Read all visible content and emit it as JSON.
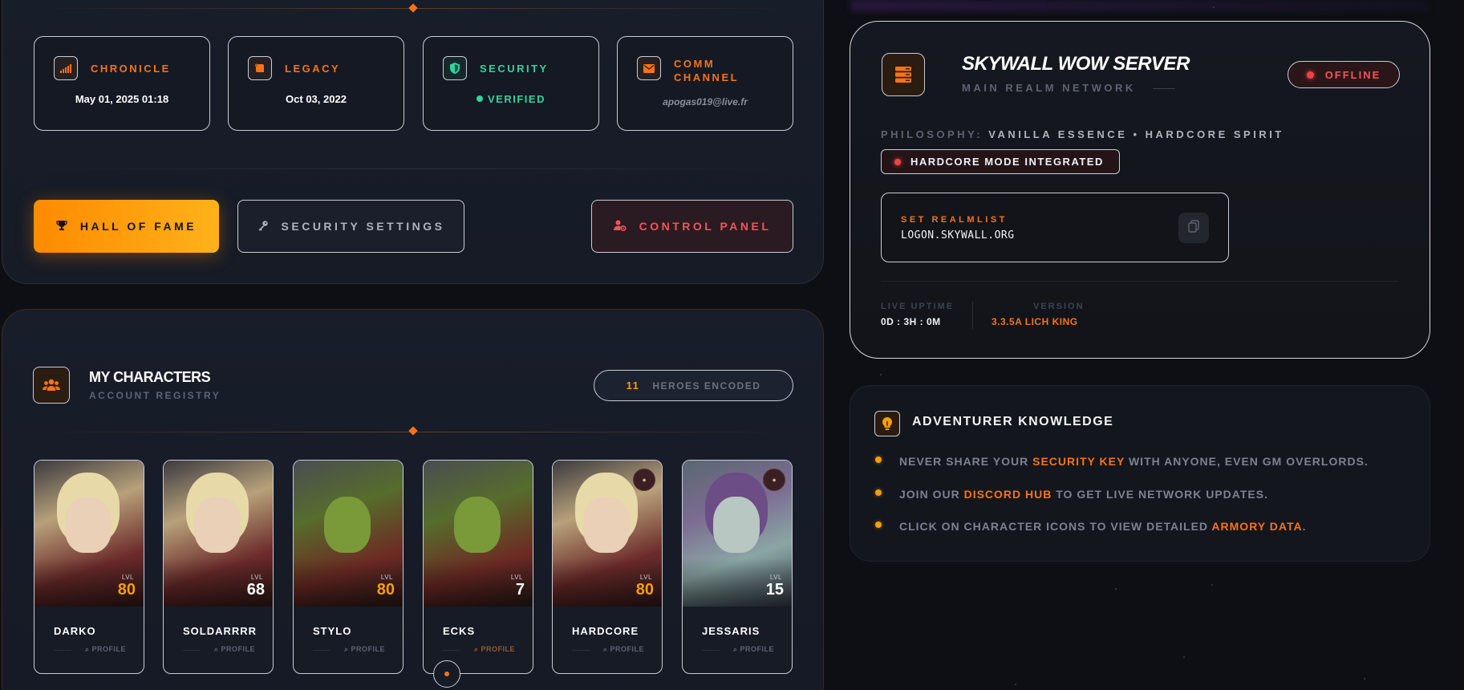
{
  "stats": [
    {
      "label": "CHRONICLE",
      "value": "May 01, 2025 01:18",
      "icon": "signal-icon"
    },
    {
      "label": "LEGACY",
      "value": "Oct 03, 2022",
      "icon": "scroll-icon"
    },
    {
      "label": "SECURITY",
      "value": "VERIFIED",
      "icon": "shield-icon"
    },
    {
      "label": "COMM CHANNEL",
      "value": "apogas019@live.fr",
      "icon": "envelope-icon"
    }
  ],
  "actions": {
    "hall_of_fame": "HALL OF FAME",
    "security_settings": "SECURITY SETTINGS",
    "control_panel": "CONTROL PANEL"
  },
  "characters_section": {
    "title": "MY CHARACTERS",
    "subtitle": "ACCOUNT REGISTRY",
    "heroes_count": "11",
    "heroes_label": "HEROES ENCODED",
    "level_tag": "LVL",
    "profile_label": "PROFILE",
    "characters": [
      {
        "name": "DARKO",
        "level": "80",
        "race": "blood-elf"
      },
      {
        "name": "SOLDARRRR",
        "level": "68",
        "race": "blood-elf"
      },
      {
        "name": "STYLO",
        "level": "80",
        "race": "orc"
      },
      {
        "name": "ECKS",
        "level": "7",
        "race": "orc"
      },
      {
        "name": "HARDCORE",
        "level": "80",
        "race": "blood-elf"
      },
      {
        "name": "JESSARIS",
        "level": "15",
        "race": "undead"
      }
    ]
  },
  "server": {
    "name": "SKYWALL WOW SERVER",
    "subtitle": "MAIN REALM NETWORK",
    "status": "OFFLINE",
    "philosophy_label": "PHILOSOPHY:",
    "philosophy_value": "VANILLA ESSENCE • HARDCORE SPIRIT",
    "hardcore_badge": "HARDCORE MODE INTEGRATED",
    "realmlist_label": "SET REALMLIST",
    "realmlist_value": "LOGON.SKYWALL.ORG",
    "uptime_label": "LIVE UPTIME",
    "uptime_value": "0D : 3H : 0M",
    "version_label": "VERSION",
    "version_value": "3.3.5A LICH KING"
  },
  "knowledge": {
    "title": "ADVENTURER KNOWLEDGE",
    "tips": [
      {
        "pre": "NEVER SHARE YOUR ",
        "highlight": "SECURITY KEY",
        "post": " WITH ANYONE, EVEN GM OVERLORDS."
      },
      {
        "pre": "JOIN OUR ",
        "highlight": "DISCORD HUB",
        "post": " TO GET LIVE NETWORK UPDATES."
      },
      {
        "pre": "CLICK ON CHARACTER ICONS TO VIEW DETAILED ",
        "highlight": "ARMORY DATA",
        "post": "."
      }
    ]
  },
  "colors": {
    "accent": "#f97316",
    "gold": "#f59e0b",
    "success": "#34d399",
    "danger": "#ef4444"
  }
}
